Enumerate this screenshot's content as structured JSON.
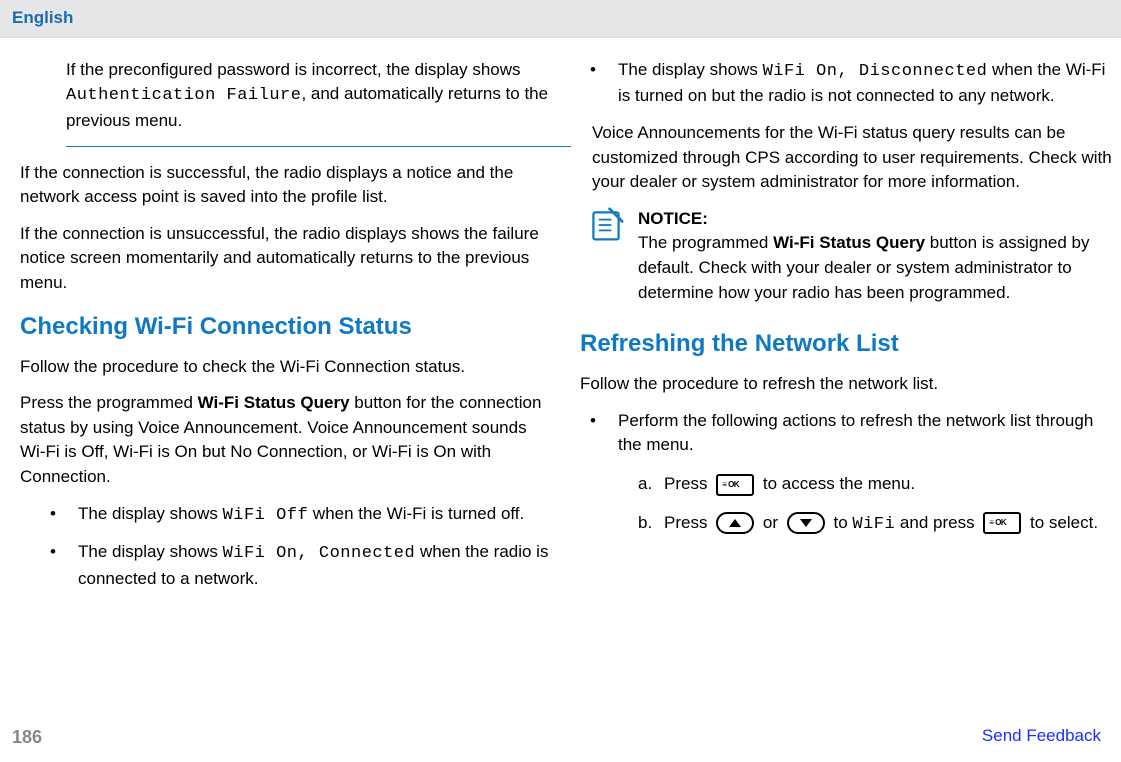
{
  "header": {
    "language": "English"
  },
  "col1": {
    "noteText1": "If the preconfigured password is incorrect, the display shows ",
    "noteCode1": "Authentication Failure",
    "noteText2": ", and automatically returns to the previous menu.",
    "p2": "If the connection is successful, the radio displays a notice and the network access point is saved into the profile list.",
    "p3": "If the connection is unsuccessful, the radio displays shows the failure notice screen momentarily and automatically returns to the previous menu.",
    "h1": "Checking Wi-Fi Connection Status",
    "p4": "Follow the procedure to check the Wi-Fi Connection status.",
    "p5a": "Press the programmed ",
    "p5bold": "Wi-Fi Status Query",
    "p5b": " button for the connection status by using Voice Announcement. Voice Announcement sounds Wi-Fi is Off, Wi-Fi is On but No Connection, or Wi-Fi is On with Connection.",
    "li1a": "The display shows ",
    "li1code": "WiFi Off",
    "li1b": " when the Wi-Fi is turned off.",
    "li2a": "The display shows ",
    "li2code": "WiFi On, Connected",
    "li2b": " when the radio is connected to a network."
  },
  "col2": {
    "li3a": "The display shows ",
    "li3code": "WiFi On, Disconnected",
    "li3b": " when the Wi-Fi is turned on but the radio is not connected to any network.",
    "p6": "Voice Announcements for the Wi-Fi status query results can be customized through CPS according to user requirements. Check with your dealer or system administrator for more information.",
    "noticeLabel": "NOTICE:",
    "noticeText1": "The programmed ",
    "noticeBold": "Wi-Fi Status Query",
    "noticeText2": " button is assigned by default. Check with your dealer or system administrator to determine how your radio has been programmed.",
    "h2": "Refreshing the Network List",
    "p7": "Follow the procedure to refresh the network list.",
    "li4": "Perform the following actions to refresh the network list through the menu.",
    "stepA1": "Press ",
    "stepA2": " to access the menu.",
    "stepB1": "Press ",
    "stepB2": " or ",
    "stepB3": " to ",
    "stepBcode": "WiFi",
    "stepB4": " and press ",
    "stepB5": " to select."
  },
  "footer": {
    "pageNum": "186",
    "feedback": "Send Feedback"
  }
}
